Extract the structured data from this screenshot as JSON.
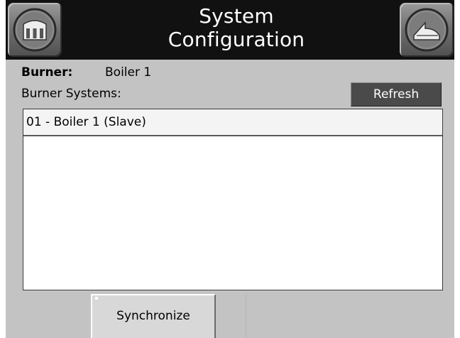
{
  "header": {
    "title_line1": "System",
    "title_line2": "Configuration",
    "home_icon": "building-icon",
    "back_icon": "back-arrow-icon"
  },
  "burner": {
    "label": "Burner:",
    "value": "Boiler 1"
  },
  "systems": {
    "label": "Burner Systems:",
    "refresh_label": "Refresh",
    "items": [
      {
        "text": "01 - Boiler 1 (Slave)"
      }
    ]
  },
  "footer": {
    "synchronize_label": "Synchronize"
  },
  "colors": {
    "header_bg": "#111111",
    "panel_bg": "#c3c3c3",
    "refresh_bg": "#4a4a4a"
  }
}
